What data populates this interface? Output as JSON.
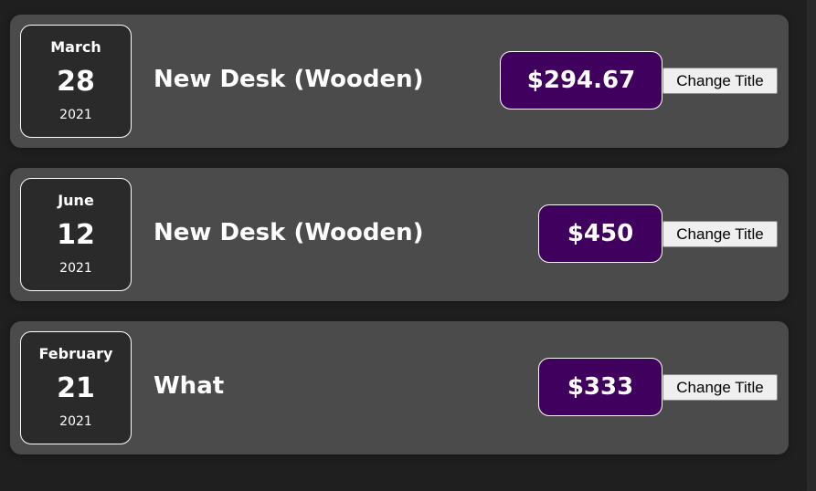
{
  "colors": {
    "page_background": "#1f1f1f",
    "item_background": "#4b4b4b",
    "date_background": "#2a2a2a",
    "price_background": "#40005d",
    "text": "#ffffff"
  },
  "expenses": [
    {
      "month": "March",
      "day": "28",
      "year": "2021",
      "title": "New Desk (Wooden)",
      "amount": "$294.67",
      "button_label": "Change Title"
    },
    {
      "month": "June",
      "day": "12",
      "year": "2021",
      "title": "New Desk (Wooden)",
      "amount": "$450",
      "button_label": "Change Title"
    },
    {
      "month": "February",
      "day": "21",
      "year": "2021",
      "title": "What",
      "amount": "$333",
      "button_label": "Change Title"
    }
  ]
}
